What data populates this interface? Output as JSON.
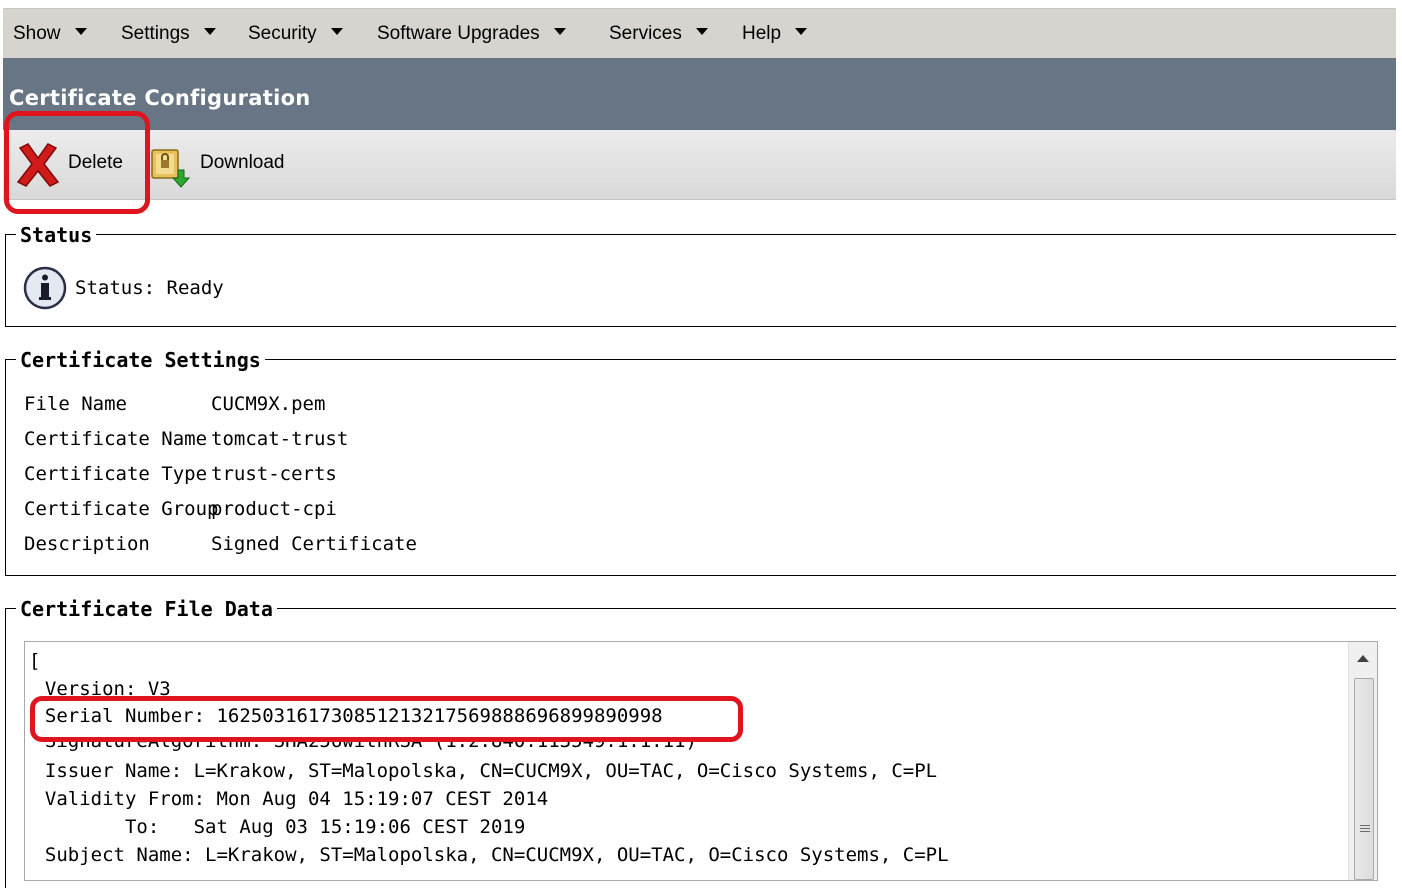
{
  "menu": {
    "items": [
      {
        "label": "Show"
      },
      {
        "label": "Settings"
      },
      {
        "label": "Security"
      },
      {
        "label": "Software Upgrades"
      },
      {
        "label": "Services"
      },
      {
        "label": "Help"
      }
    ]
  },
  "page": {
    "title": "Certificate Configuration"
  },
  "toolbar": {
    "delete_label": "Delete",
    "download_label": "Download"
  },
  "status": {
    "legend": "Status",
    "text": "Status: Ready"
  },
  "settings": {
    "legend": "Certificate Settings",
    "rows": [
      {
        "label": "File Name",
        "value": "CUCM9X.pem"
      },
      {
        "label": "Certificate Name",
        "value": "tomcat-trust"
      },
      {
        "label": "Certificate Type",
        "value": "trust-certs"
      },
      {
        "label": "Certificate Group",
        "value": "product-cpi"
      },
      {
        "label": "Description",
        "value": "Signed Certificate"
      }
    ]
  },
  "file_data": {
    "legend": "Certificate File Data",
    "lines": [
      "[",
      "  Version: V3",
      "  Serial Number: 162503161730851213217569888696899890998",
      "  SignatureAlgorithm: SHA256withRSA (1.2.840.113549.1.1.11)",
      "  Issuer Name: L=Krakow, ST=Malopolska, CN=CUCM9X, OU=TAC, O=Cisco Systems, C=PL",
      "  Validity From: Mon Aug 04 15:19:07 CEST 2014",
      "         To:   Sat Aug 03 15:19:06 CEST 2019",
      "  Subject Name: L=Krakow, ST=Malopolska, CN=CUCM9X, OU=TAC, O=Cisco Systems, C=PL"
    ]
  },
  "colors": {
    "highlight": "#e0141e",
    "titlebar": "#687585",
    "menubar": "#d7d4cf"
  },
  "icons": {
    "delete": "red-x-icon",
    "download": "certificate-download-icon",
    "info": "info-icon"
  }
}
